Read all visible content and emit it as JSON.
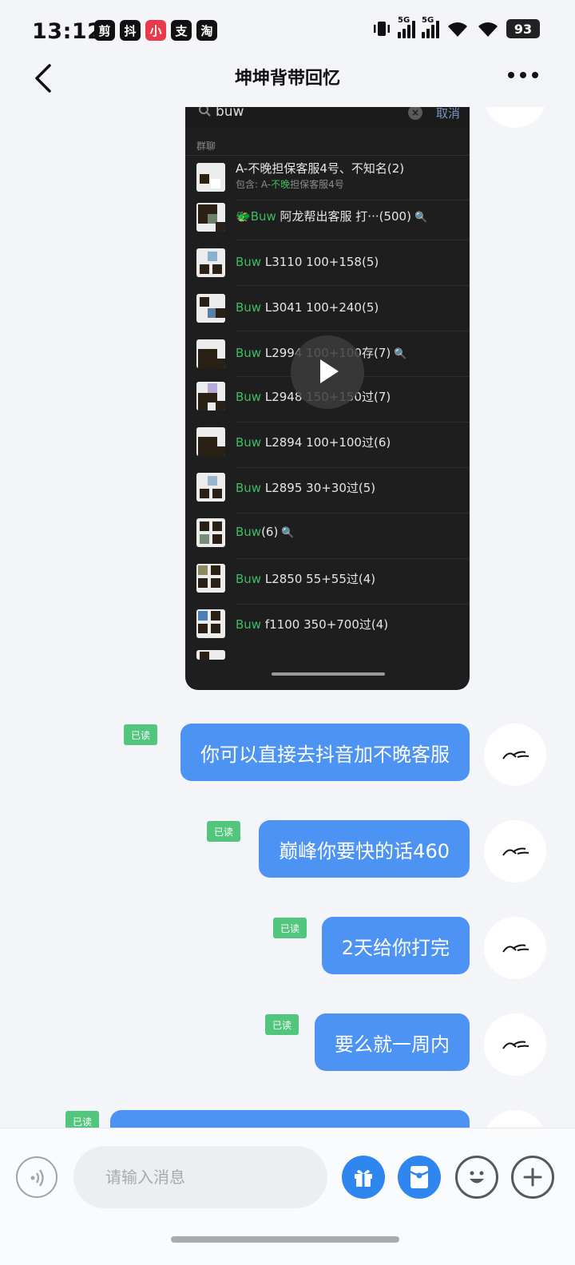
{
  "status_bar": {
    "time": "13:12",
    "app_icons": [
      "剪",
      "抖",
      "小",
      "支",
      "淘"
    ],
    "signal_1": "5G",
    "signal_2": "5G",
    "battery": "93"
  },
  "header": {
    "title": "坤坤背带回忆",
    "back_icon": "chevron-left-icon",
    "more_icon": "more-dots-icon"
  },
  "embedded_screenshot": {
    "search_query": "buw",
    "cancel_label": "取消",
    "section_label": "群聊",
    "rows": [
      {
        "name": "A-不晚担保客服4号、不知名(2)",
        "sub_prefix": "包含: A-",
        "sub_highlight": "不晚",
        "sub_suffix": "担保客服4号"
      },
      {
        "highlight": "Buw",
        "prefix": "🐲",
        "rest": " 阿龙帮出客服 打···(500)",
        "tag": "🔍"
      },
      {
        "highlight": "Buw",
        "rest": " L3110 100+158(5)"
      },
      {
        "highlight": "Buw",
        "rest": " L3041 100+240(5)"
      },
      {
        "highlight": "Buw",
        "rest": " L2994 100+100存(7)",
        "tag": "🔍"
      },
      {
        "highlight": "Buw",
        "rest": " L2948 150+150过(7)"
      },
      {
        "highlight": "Buw",
        "rest": " L2894 100+100过(6)"
      },
      {
        "highlight": "Buw",
        "rest": " L2895 30+30过(5)"
      },
      {
        "highlight": "Buw",
        "rest": "(6)",
        "tag": "🔍"
      },
      {
        "highlight": "Buw",
        "rest": " L2850 55+55过(4)"
      },
      {
        "highlight": "Buw",
        "rest": " f1100 350+700过(4)"
      }
    ]
  },
  "messages": [
    {
      "text": "你可以直接去抖音加不晚客服",
      "read": "已读"
    },
    {
      "text": "巅峰你要快的话460",
      "read": "已读"
    },
    {
      "text": "2天给你打完",
      "read": "已读"
    },
    {
      "text": "要么就一周内",
      "read": "已读"
    },
    {
      "text": "",
      "read": "已读"
    }
  ],
  "input_bar": {
    "placeholder": "请输入消息",
    "voice_icon": "voice-icon",
    "gift_icon": "gift-icon",
    "red_packet_icon": "red-packet-icon",
    "emoji_icon": "emoji-icon",
    "plus_icon": "plus-icon"
  },
  "colors": {
    "bubble": "#4d93f3",
    "read_badge": "#52c67d",
    "highlight": "#3fbc63",
    "background": "#f3f5f8"
  }
}
